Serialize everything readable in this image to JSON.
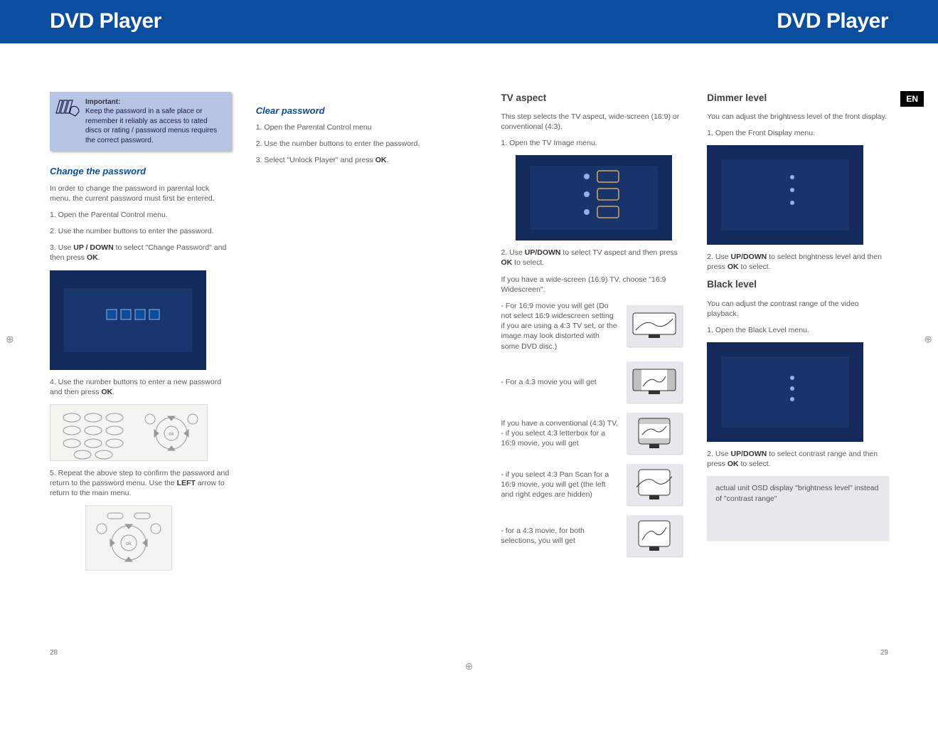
{
  "titleLeft": "DVD Player",
  "titleRight": "DVD Player",
  "langTab": "EN",
  "pageNumLeft": "28",
  "pageNumRight": "29",
  "important": {
    "heading": "Important:",
    "body": "Keep the password in a safe place or remember it reliably as access to rated discs or rating / password menus requires the correct password."
  },
  "changePassword": {
    "heading": "Change  the password",
    "intro": "In order to change the password in parental lock menu, the current password must first be entered.",
    "step1": "1. Open the Parental Control menu.",
    "step2": "2. Use the number buttons to enter the password.",
    "step3a": "3. Use ",
    "step3b": "UP / DOWN",
    "step3c": " to select \"Change Password\" and then press ",
    "step3d": "OK",
    "step3e": ".",
    "step4a": "4. Use the number buttons to enter a new password and then press ",
    "step4b": "OK",
    "step4c": ".",
    "step5a": "5. Repeat the above step to confirm the password and return to the password menu. Use the ",
    "step5b": "LEFT",
    "step5c": " arrow to return to the main menu."
  },
  "clearPassword": {
    "heading": "Clear password",
    "step1": "1. Open the Parental Control menu",
    "step2": "2. Use the number buttons to enter the password.",
    "step3a": "3. Select \"Unlock Player\" and press ",
    "step3b": "OK",
    "step3c": "."
  },
  "tvAspect": {
    "heading": "TV aspect",
    "intro": "This step selects the TV aspect, wide-screen (16:9) or conventional (4:3).",
    "step1": "1. Open the TV Image menu.",
    "step2a": "2. Use ",
    "step2b": "UP/DOWN",
    "step2c": " to select TV aspect and then press ",
    "step2d": "OK",
    "step2e": " to select.",
    "wideIntro": "If you have a wide-screen (16:9) TV, choose \"16:9 Widescreen\".",
    "wide169": "- For 16:9 movie you will get (Do not select 16:9 widescreen setting if you are using a 4:3 TV set, or the image may look distorted with some DVD disc.)",
    "wide43": "- For a 4:3 movie you will get",
    "conv": "If you have a conventional (4:3) TV, - if you select 4:3 letterbox for a 16:9 movie, you will get",
    "panscan": "- if you select 4:3 Pan Scan for a 16:9 movie, you will get (the left and right edges are hidden)",
    "conv43": "- for a 4:3 movie, for both selections, you will get"
  },
  "dimmer": {
    "heading": "Dimmer level",
    "intro": "You can adjust the brightness level of the front display.",
    "step1": "1. Open the Front Display menu.",
    "step2a": "2. Use ",
    "step2b": "UP/DOWN",
    "step2c": " to select brightness level and then press ",
    "step2d": "OK",
    "step2e": " to select."
  },
  "black": {
    "heading": "Black level",
    "intro": "You can adjust the contrast range of the video playback.",
    "step1": "1. Open the Black Level menu.",
    "step2a": "2. Use ",
    "step2b": "UP/DOWN",
    "step2c": " to select contrast range and then press ",
    "step2d": "OK",
    "step2e": " to select.",
    "note": "actual unit OSD display \"brightness level\" instead of \"contrast range\""
  }
}
